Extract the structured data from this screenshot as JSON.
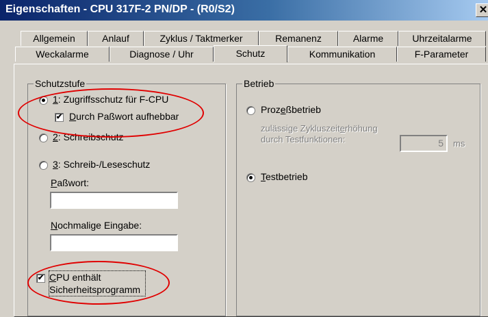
{
  "window": {
    "title": "Eigenschaften - CPU 317F-2 PN/DP - (R0/S2)",
    "close_glyph": "✕"
  },
  "tabs": {
    "row1": [
      "Allgemein",
      "Anlauf",
      "Zyklus / Taktmerker",
      "Remanenz",
      "Alarme",
      "Uhrzeitalarme"
    ],
    "row2": [
      "Weckalarme",
      "Diagnose / Uhr",
      "Schutz",
      "Kommunikation",
      "F-Parameter"
    ],
    "active": "Schutz"
  },
  "schutzstufe": {
    "legend": "Schutzstufe",
    "opt1_num": "1",
    "opt1_text": ": Zugriffsschutz für F-CPU",
    "opt1_checkbox_pre": "D",
    "opt1_checkbox_rest": "urch Paßwort aufhebbar",
    "opt2_num": "2",
    "opt2_text": ": Schreibschutz",
    "opt3_num": "3",
    "opt3_text": ": Schreib-/Leseschutz",
    "password_label_pre": "P",
    "password_label_rest": "aßwort:",
    "password_value": "",
    "repeat_label_pre": "N",
    "repeat_label_rest": "ochmalige Eingabe:",
    "repeat_value": "",
    "safety_checkbox_line1_pre": "C",
    "safety_checkbox_line1_rest": "PU enthält",
    "safety_checkbox_line2": "Sicherheitsprogramm",
    "check_glyph": "✔",
    "selected": 1,
    "opt1_checkbox_checked": true,
    "safety_checked": true
  },
  "betrieb": {
    "legend": "Betrieb",
    "prozess_pre": "Proz",
    "prozess_u": "e",
    "prozess_rest": "ßbetrieb",
    "hint_line1_pre": "zulässige Zykluszeit",
    "hint_line1_u": "e",
    "hint_line1_rest": "rhöhung",
    "hint_line2": "durch Testfunktionen:",
    "increase_value": "5",
    "unit": "ms",
    "test_u": "T",
    "test_rest": "estbetrieb",
    "selected": "Testbetrieb"
  },
  "colors": {
    "annotation": "#e00000",
    "title_bar": "#0a246a",
    "face": "#d4d0c8"
  }
}
